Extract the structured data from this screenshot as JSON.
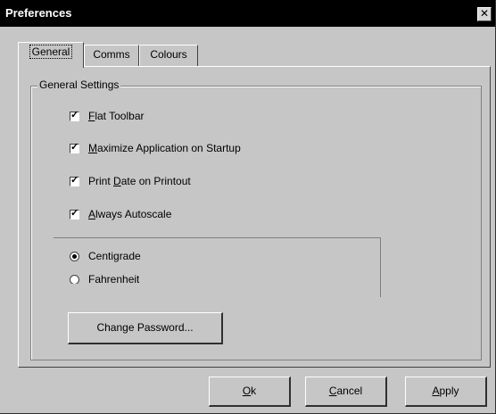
{
  "window": {
    "title": "Preferences",
    "close_glyph": "✕"
  },
  "tabs": [
    {
      "label": "General",
      "active": true
    },
    {
      "label": "Comms",
      "active": false
    },
    {
      "label": "Colours",
      "active": false
    }
  ],
  "group": {
    "label": "General Settings"
  },
  "checkboxes": [
    {
      "label_pre": "",
      "accel": "F",
      "label_post": "lat Toolbar",
      "checked": true
    },
    {
      "label_pre": "",
      "accel": "M",
      "label_post": "aximize Application on Startup",
      "checked": true
    },
    {
      "label_pre": "Print ",
      "accel": "D",
      "label_post": "ate on Printout",
      "checked": true
    },
    {
      "label_pre": "",
      "accel": "A",
      "label_post": "lways Autoscale",
      "checked": true
    }
  ],
  "check_glyph": "✓",
  "radios": [
    {
      "label": "Centigrade",
      "selected": true
    },
    {
      "label": "Fahrenheit",
      "selected": false
    }
  ],
  "buttons": {
    "change_password": "Change Password...",
    "ok_accel": "O",
    "ok_rest": "k",
    "cancel_accel": "C",
    "cancel_rest": "ancel",
    "apply_accel": "A",
    "apply_rest": "pply"
  }
}
